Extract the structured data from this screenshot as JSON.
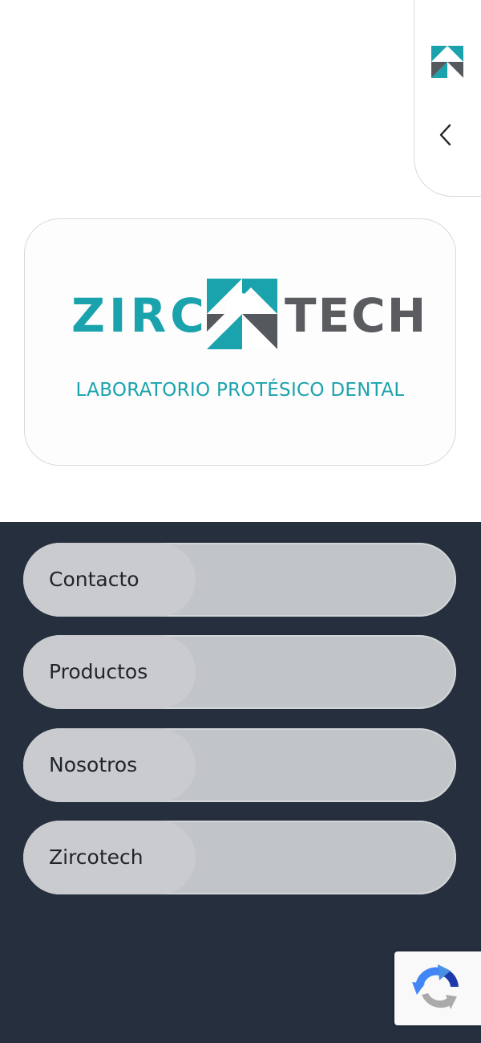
{
  "side_panel": {
    "logo_icon": "zircotech-mark-icon",
    "back_icon": "chevron-left-icon"
  },
  "brand": {
    "name_part1": "ZIRC",
    "name_part2": "TECH",
    "tagline": "LABORATORIO PROTÉSICO DENTAL",
    "colors": {
      "teal": "#1aa3ad",
      "gray": "#5a5c60"
    }
  },
  "nav": {
    "background": "#262f3d",
    "items": [
      {
        "label": "Contacto"
      },
      {
        "label": "Productos"
      },
      {
        "label": "Nosotros"
      },
      {
        "label": "Zircotech"
      }
    ]
  },
  "recaptcha": {
    "icon": "recaptcha-icon"
  }
}
